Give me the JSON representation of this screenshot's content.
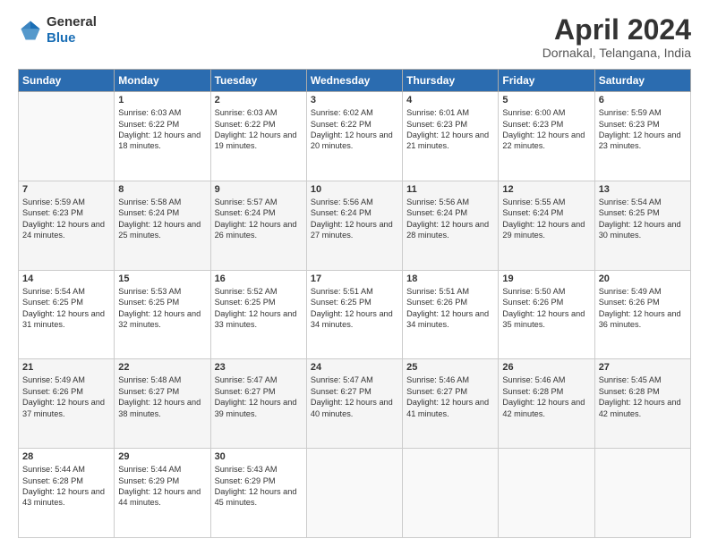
{
  "header": {
    "logo": {
      "line1": "General",
      "line2": "Blue"
    },
    "title": "April 2024",
    "location": "Dornakal, Telangana, India"
  },
  "weekdays": [
    "Sunday",
    "Monday",
    "Tuesday",
    "Wednesday",
    "Thursday",
    "Friday",
    "Saturday"
  ],
  "weeks": [
    [
      {
        "day": "",
        "sunrise": "",
        "sunset": "",
        "daylight": ""
      },
      {
        "day": "1",
        "sunrise": "Sunrise: 6:03 AM",
        "sunset": "Sunset: 6:22 PM",
        "daylight": "Daylight: 12 hours and 18 minutes."
      },
      {
        "day": "2",
        "sunrise": "Sunrise: 6:03 AM",
        "sunset": "Sunset: 6:22 PM",
        "daylight": "Daylight: 12 hours and 19 minutes."
      },
      {
        "day": "3",
        "sunrise": "Sunrise: 6:02 AM",
        "sunset": "Sunset: 6:22 PM",
        "daylight": "Daylight: 12 hours and 20 minutes."
      },
      {
        "day": "4",
        "sunrise": "Sunrise: 6:01 AM",
        "sunset": "Sunset: 6:23 PM",
        "daylight": "Daylight: 12 hours and 21 minutes."
      },
      {
        "day": "5",
        "sunrise": "Sunrise: 6:00 AM",
        "sunset": "Sunset: 6:23 PM",
        "daylight": "Daylight: 12 hours and 22 minutes."
      },
      {
        "day": "6",
        "sunrise": "Sunrise: 5:59 AM",
        "sunset": "Sunset: 6:23 PM",
        "daylight": "Daylight: 12 hours and 23 minutes."
      }
    ],
    [
      {
        "day": "7",
        "sunrise": "Sunrise: 5:59 AM",
        "sunset": "Sunset: 6:23 PM",
        "daylight": "Daylight: 12 hours and 24 minutes."
      },
      {
        "day": "8",
        "sunrise": "Sunrise: 5:58 AM",
        "sunset": "Sunset: 6:24 PM",
        "daylight": "Daylight: 12 hours and 25 minutes."
      },
      {
        "day": "9",
        "sunrise": "Sunrise: 5:57 AM",
        "sunset": "Sunset: 6:24 PM",
        "daylight": "Daylight: 12 hours and 26 minutes."
      },
      {
        "day": "10",
        "sunrise": "Sunrise: 5:56 AM",
        "sunset": "Sunset: 6:24 PM",
        "daylight": "Daylight: 12 hours and 27 minutes."
      },
      {
        "day": "11",
        "sunrise": "Sunrise: 5:56 AM",
        "sunset": "Sunset: 6:24 PM",
        "daylight": "Daylight: 12 hours and 28 minutes."
      },
      {
        "day": "12",
        "sunrise": "Sunrise: 5:55 AM",
        "sunset": "Sunset: 6:24 PM",
        "daylight": "Daylight: 12 hours and 29 minutes."
      },
      {
        "day": "13",
        "sunrise": "Sunrise: 5:54 AM",
        "sunset": "Sunset: 6:25 PM",
        "daylight": "Daylight: 12 hours and 30 minutes."
      }
    ],
    [
      {
        "day": "14",
        "sunrise": "Sunrise: 5:54 AM",
        "sunset": "Sunset: 6:25 PM",
        "daylight": "Daylight: 12 hours and 31 minutes."
      },
      {
        "day": "15",
        "sunrise": "Sunrise: 5:53 AM",
        "sunset": "Sunset: 6:25 PM",
        "daylight": "Daylight: 12 hours and 32 minutes."
      },
      {
        "day": "16",
        "sunrise": "Sunrise: 5:52 AM",
        "sunset": "Sunset: 6:25 PM",
        "daylight": "Daylight: 12 hours and 33 minutes."
      },
      {
        "day": "17",
        "sunrise": "Sunrise: 5:51 AM",
        "sunset": "Sunset: 6:25 PM",
        "daylight": "Daylight: 12 hours and 34 minutes."
      },
      {
        "day": "18",
        "sunrise": "Sunrise: 5:51 AM",
        "sunset": "Sunset: 6:26 PM",
        "daylight": "Daylight: 12 hours and 34 minutes."
      },
      {
        "day": "19",
        "sunrise": "Sunrise: 5:50 AM",
        "sunset": "Sunset: 6:26 PM",
        "daylight": "Daylight: 12 hours and 35 minutes."
      },
      {
        "day": "20",
        "sunrise": "Sunrise: 5:49 AM",
        "sunset": "Sunset: 6:26 PM",
        "daylight": "Daylight: 12 hours and 36 minutes."
      }
    ],
    [
      {
        "day": "21",
        "sunrise": "Sunrise: 5:49 AM",
        "sunset": "Sunset: 6:26 PM",
        "daylight": "Daylight: 12 hours and 37 minutes."
      },
      {
        "day": "22",
        "sunrise": "Sunrise: 5:48 AM",
        "sunset": "Sunset: 6:27 PM",
        "daylight": "Daylight: 12 hours and 38 minutes."
      },
      {
        "day": "23",
        "sunrise": "Sunrise: 5:47 AM",
        "sunset": "Sunset: 6:27 PM",
        "daylight": "Daylight: 12 hours and 39 minutes."
      },
      {
        "day": "24",
        "sunrise": "Sunrise: 5:47 AM",
        "sunset": "Sunset: 6:27 PM",
        "daylight": "Daylight: 12 hours and 40 minutes."
      },
      {
        "day": "25",
        "sunrise": "Sunrise: 5:46 AM",
        "sunset": "Sunset: 6:27 PM",
        "daylight": "Daylight: 12 hours and 41 minutes."
      },
      {
        "day": "26",
        "sunrise": "Sunrise: 5:46 AM",
        "sunset": "Sunset: 6:28 PM",
        "daylight": "Daylight: 12 hours and 42 minutes."
      },
      {
        "day": "27",
        "sunrise": "Sunrise: 5:45 AM",
        "sunset": "Sunset: 6:28 PM",
        "daylight": "Daylight: 12 hours and 42 minutes."
      }
    ],
    [
      {
        "day": "28",
        "sunrise": "Sunrise: 5:44 AM",
        "sunset": "Sunset: 6:28 PM",
        "daylight": "Daylight: 12 hours and 43 minutes."
      },
      {
        "day": "29",
        "sunrise": "Sunrise: 5:44 AM",
        "sunset": "Sunset: 6:29 PM",
        "daylight": "Daylight: 12 hours and 44 minutes."
      },
      {
        "day": "30",
        "sunrise": "Sunrise: 5:43 AM",
        "sunset": "Sunset: 6:29 PM",
        "daylight": "Daylight: 12 hours and 45 minutes."
      },
      {
        "day": "",
        "sunrise": "",
        "sunset": "",
        "daylight": ""
      },
      {
        "day": "",
        "sunrise": "",
        "sunset": "",
        "daylight": ""
      },
      {
        "day": "",
        "sunrise": "",
        "sunset": "",
        "daylight": ""
      },
      {
        "day": "",
        "sunrise": "",
        "sunset": "",
        "daylight": ""
      }
    ]
  ]
}
